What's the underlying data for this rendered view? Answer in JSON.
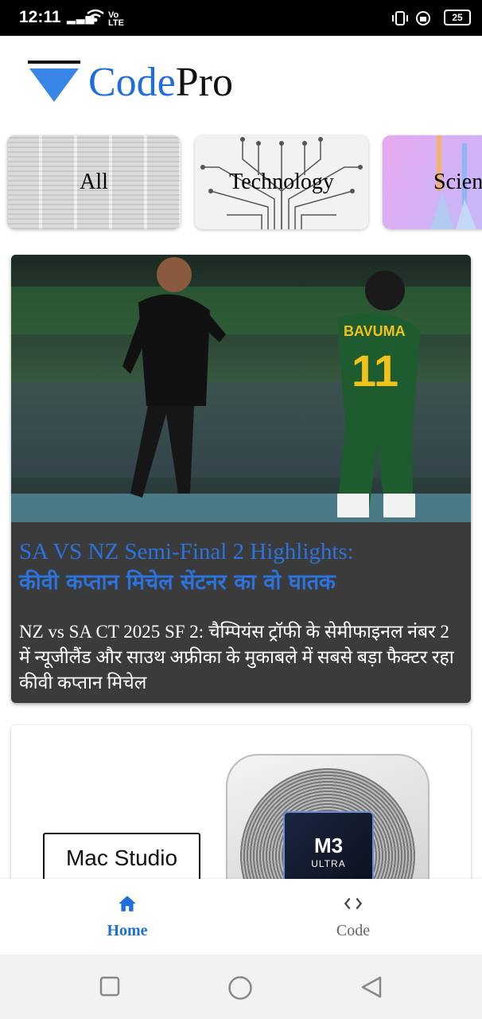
{
  "status_bar": {
    "time": "12:11",
    "volte_top": "Vo",
    "volte_bottom": "LTE",
    "battery": "25"
  },
  "header": {
    "brand_part1": "Code",
    "brand_part2": "Pro",
    "accent_color": "#1e6fdc"
  },
  "categories": [
    {
      "label": "All"
    },
    {
      "label": "Technology"
    },
    {
      "label": "Scien"
    }
  ],
  "articles": [
    {
      "title_line1": "SA VS NZ Semi-Final 2 Highlights:",
      "title_line2": "कीवी कप्तान मिचेल सेंटनर का वो घातक",
      "description": "NZ vs SA CT 2025 SF 2: चैम्पियंस ट्रॉफी के सेमीफाइनल नंबर 2 में न्यूजीलैंड और साउथ अफ्रीका के मुकाबले में सबसे बड़ा फैक्टर रहा कीवी कप्तान मिचेल",
      "image_jersey_text": "BAVUMA",
      "image_jersey_number": "11"
    },
    {
      "image_label": "Mac Studio",
      "image_chip_text": "M3",
      "image_chip_subtext": "ULTRA"
    }
  ],
  "bottom_nav": {
    "home_label": "Home",
    "code_label": "Code"
  }
}
